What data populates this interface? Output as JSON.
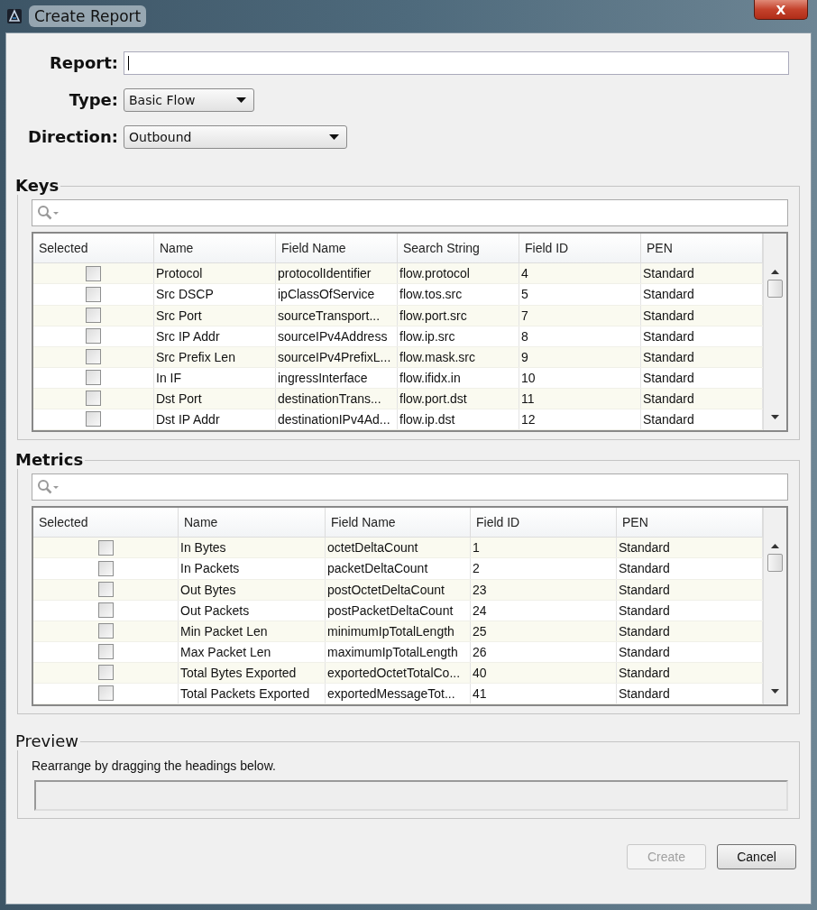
{
  "window": {
    "title": "Create Report",
    "close": "X"
  },
  "form": {
    "report": {
      "label": "Report:"
    },
    "type": {
      "label": "Type:",
      "value": "Basic Flow"
    },
    "direction": {
      "label": "Direction:",
      "value": "Outbound"
    }
  },
  "keys": {
    "title": "Keys",
    "columns": [
      "Selected",
      "Name",
      "Field Name",
      "Search String",
      "Field ID",
      "PEN"
    ],
    "rows": [
      {
        "cells": [
          {
            "checked": false
          },
          "Protocol",
          "protocolIdentifier",
          "flow.protocol",
          "4",
          "Standard"
        ]
      },
      {
        "cells": [
          {
            "checked": false
          },
          "Src DSCP",
          "ipClassOfService",
          "flow.tos.src",
          "5",
          "Standard"
        ]
      },
      {
        "cells": [
          {
            "checked": false
          },
          "Src Port",
          "sourceTransport...",
          "flow.port.src",
          "7",
          "Standard"
        ]
      },
      {
        "cells": [
          {
            "checked": false
          },
          "Src IP Addr",
          "sourceIPv4Address",
          "flow.ip.src",
          "8",
          "Standard"
        ]
      },
      {
        "cells": [
          {
            "checked": false
          },
          "Src Prefix Len",
          "sourceIPv4PrefixL...",
          "flow.mask.src",
          "9",
          "Standard"
        ]
      },
      {
        "cells": [
          {
            "checked": false
          },
          "In IF",
          "ingressInterface",
          "flow.ifidx.in",
          "10",
          "Standard"
        ]
      },
      {
        "cells": [
          {
            "checked": false
          },
          "Dst Port",
          "destinationTrans...",
          "flow.port.dst",
          "11",
          "Standard"
        ]
      },
      {
        "cells": [
          {
            "checked": false
          },
          "Dst IP Addr",
          "destinationIPv4Ad...",
          "flow.ip.dst",
          "12",
          "Standard"
        ]
      }
    ]
  },
  "metrics": {
    "title": "Metrics",
    "columns": [
      "Selected",
      "Name",
      "Field Name",
      "Field ID",
      "PEN"
    ],
    "rows": [
      {
        "cells": [
          {
            "checked": false
          },
          "In Bytes",
          "octetDeltaCount",
          "1",
          "Standard"
        ]
      },
      {
        "cells": [
          {
            "checked": false
          },
          "In Packets",
          "packetDeltaCount",
          "2",
          "Standard"
        ]
      },
      {
        "cells": [
          {
            "checked": false
          },
          "Out Bytes",
          "postOctetDeltaCount",
          "23",
          "Standard"
        ]
      },
      {
        "cells": [
          {
            "checked": false
          },
          "Out Packets",
          "postPacketDeltaCount",
          "24",
          "Standard"
        ]
      },
      {
        "cells": [
          {
            "checked": false
          },
          "Min Packet Len",
          "minimumIpTotalLength",
          "25",
          "Standard"
        ]
      },
      {
        "cells": [
          {
            "checked": false
          },
          "Max Packet Len",
          "maximumIpTotalLength",
          "26",
          "Standard"
        ]
      },
      {
        "cells": [
          {
            "checked": false
          },
          "Total Bytes Exported",
          "exportedOctetTotalCo...",
          "40",
          "Standard"
        ]
      },
      {
        "cells": [
          {
            "checked": false
          },
          "Total Packets Exported",
          "exportedMessageTot...",
          "41",
          "Standard"
        ]
      }
    ]
  },
  "preview": {
    "title": "Preview",
    "hint": "Rearrange by dragging the headings below."
  },
  "buttons": [
    {
      "label": "Create",
      "disabled": true
    },
    {
      "label": "Cancel",
      "disabled": false
    }
  ]
}
